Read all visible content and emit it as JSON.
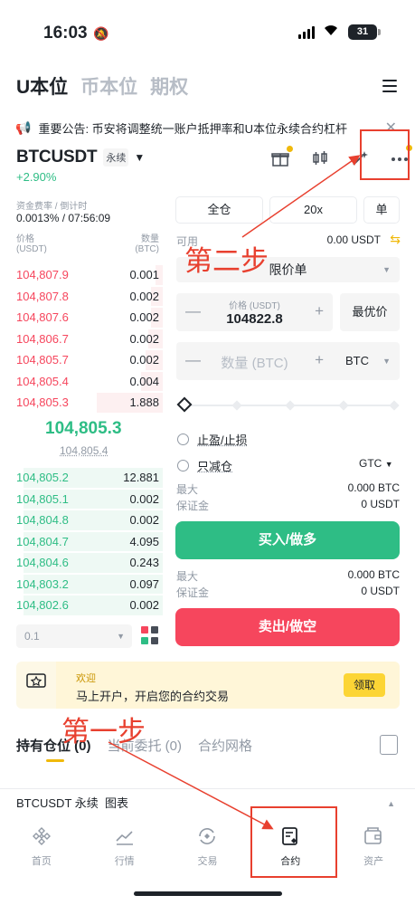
{
  "status": {
    "time": "16:03",
    "battery": "31"
  },
  "top_tabs": [
    {
      "label": "U本位",
      "active": true
    },
    {
      "label": "币本位",
      "active": false
    },
    {
      "label": "期权",
      "active": false
    }
  ],
  "announcement": "重要公告: 币安将调整统一账户抵押率和U本位永续合约杠杆",
  "pair": {
    "symbol": "BTCUSDT",
    "type": "永续",
    "change": "+2.90%"
  },
  "funding": {
    "label": "资金费率 / 倒计时",
    "value": "0.0013% / 07:56:09"
  },
  "orderbook": {
    "price_label": "价格",
    "price_unit": "(USDT)",
    "qty_label": "数量",
    "qty_unit": "(BTC)",
    "asks": [
      {
        "price": "104,807.9",
        "qty": "0.001",
        "depth": 0.05
      },
      {
        "price": "104,807.8",
        "qty": "0.002",
        "depth": 0.08
      },
      {
        "price": "104,807.6",
        "qty": "0.002",
        "depth": 0.08
      },
      {
        "price": "104,806.7",
        "qty": "0.002",
        "depth": 0.1
      },
      {
        "price": "104,805.7",
        "qty": "0.002",
        "depth": 0.12
      },
      {
        "price": "104,805.4",
        "qty": "0.004",
        "depth": 0.15
      },
      {
        "price": "104,805.3",
        "qty": "1.888",
        "depth": 0.45
      }
    ],
    "mid_price": "104,805.3",
    "mark_price": "104,805.4",
    "bids": [
      {
        "price": "104,805.2",
        "qty": "12.881",
        "depth": 0.95
      },
      {
        "price": "104,805.1",
        "qty": "0.002",
        "depth": 0.95
      },
      {
        "price": "104,804.8",
        "qty": "0.002",
        "depth": 0.95
      },
      {
        "price": "104,804.7",
        "qty": "4.095",
        "depth": 0.95
      },
      {
        "price": "104,804.6",
        "qty": "0.243",
        "depth": 0.95
      },
      {
        "price": "104,803.2",
        "qty": "0.097",
        "depth": 0.95
      },
      {
        "price": "104,802.6",
        "qty": "0.002",
        "depth": 0.95
      }
    ],
    "depth_step": "0.1"
  },
  "controls": {
    "margin_mode": "全仓",
    "leverage": "20x",
    "position_mode": "单"
  },
  "available": {
    "label": "可用",
    "value": "0.00 USDT"
  },
  "order_type": "限价单",
  "price_input": {
    "label": "价格 (USDT)",
    "value": "104822.8"
  },
  "best_price": "最优价",
  "qty_input": {
    "placeholder": "数量 (BTC)"
  },
  "qty_unit": "BTC",
  "options": {
    "tp_sl": "止盈/止损",
    "reduce_only": "只减仓",
    "tif": "GTC"
  },
  "buy_info": [
    {
      "k": "最大",
      "v": "0.000 BTC"
    },
    {
      "k": "保证金",
      "v": "0 USDT"
    }
  ],
  "buy_label": "买入/做多",
  "sell_info": [
    {
      "k": "最大",
      "v": "0.000 BTC"
    },
    {
      "k": "保证金",
      "v": "0 USDT"
    }
  ],
  "sell_label": "卖出/做空",
  "promo": {
    "title": "欢迎",
    "text": "马上开户，开启您的合约交易",
    "button": "领取"
  },
  "position_tabs": [
    {
      "label": "持有仓位 (0)",
      "active": true
    },
    {
      "label": "当前委托 (0)",
      "active": false
    },
    {
      "label": "合约网格",
      "active": false
    }
  ],
  "chart_bar": "BTCUSDT 永续  图表",
  "nav": [
    {
      "label": "首页",
      "icon": "binance-logo-icon",
      "active": false
    },
    {
      "label": "行情",
      "icon": "chart-line-icon",
      "active": false
    },
    {
      "label": "交易",
      "icon": "exchange-icon",
      "active": false
    },
    {
      "label": "合约",
      "icon": "futures-doc-icon",
      "active": true
    },
    {
      "label": "资产",
      "icon": "wallet-icon",
      "active": false
    }
  ],
  "annotations": {
    "step1": "第一步",
    "step2": "第二步"
  },
  "colors": {
    "accent": "#f0b90b",
    "buy": "#2ebd85",
    "sell": "#f6465d",
    "annotation": "#e8402f"
  }
}
